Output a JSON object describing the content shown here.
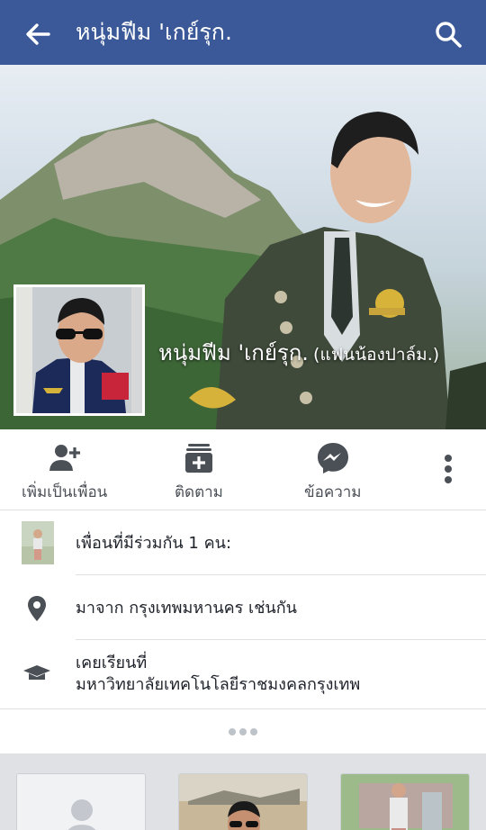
{
  "header": {
    "title": "หนุ่มฟีม 'เกย์รุก.",
    "back_icon": "arrow-left-icon",
    "search_icon": "search-icon",
    "background": "#3b5998"
  },
  "cover": {
    "name": "หนุ่มฟีม 'เกย์รุก.",
    "alternate_name": "(แฟนน้องปาล์ม.)"
  },
  "actions": [
    {
      "label": "เพิ่มเป็นเพื่อน",
      "icon": "add-friend-icon"
    },
    {
      "label": "ติดตาม",
      "icon": "follow-icon"
    },
    {
      "label": "ข้อความ",
      "icon": "messenger-icon"
    }
  ],
  "more_icon": "more-vertical-icon",
  "info": {
    "mutual_friends": "เพื่อนที่มีร่วมกัน 1 คน: ",
    "from": "มาจาก กรุงเทพมหานคร เช่นกัน",
    "studied_at_label": "เคยเรียนที่",
    "studied_at": "มหาวิทยาลัยเทคโนโลยีราชมงคลกรุงเทพ"
  },
  "colors": {
    "brand": "#3b5998",
    "icon_gray": "#4b4f56",
    "divider": "#dddfe2"
  }
}
